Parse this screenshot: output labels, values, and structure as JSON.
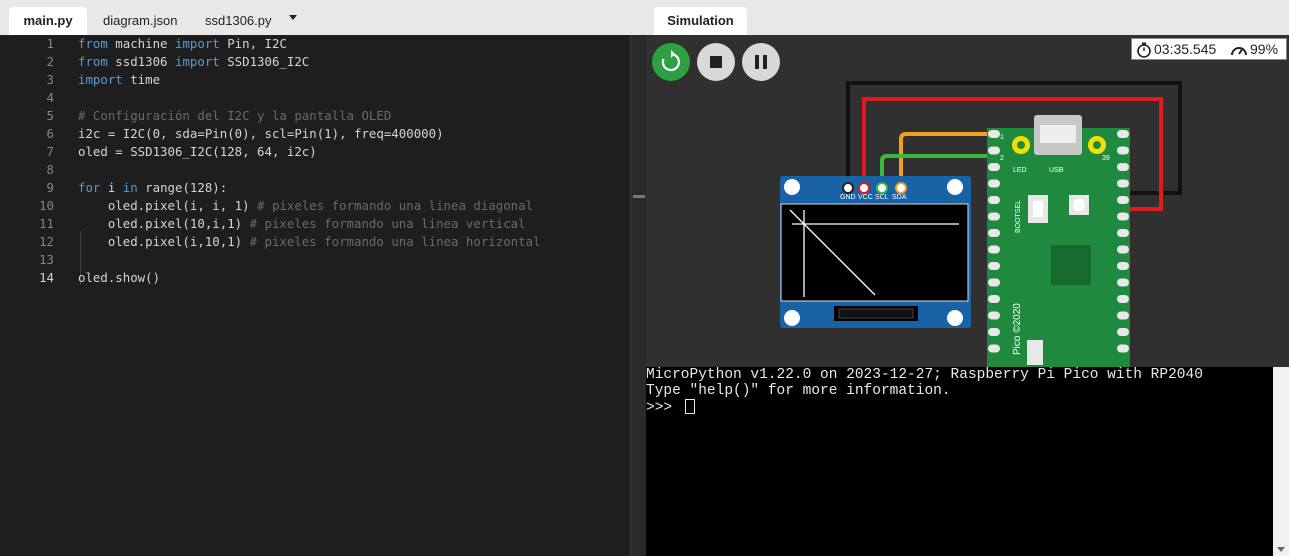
{
  "editor": {
    "tabs": [
      {
        "label": "main.py",
        "active": true
      },
      {
        "label": "diagram.json",
        "active": false
      },
      {
        "label": "ssd1306.py",
        "active": false
      }
    ],
    "current_line": 14,
    "lines": [
      {
        "n": "1",
        "tokens": [
          [
            "kw",
            "from"
          ],
          [
            "nm",
            " machine "
          ],
          [
            "kw",
            "import"
          ],
          [
            "nm",
            " Pin, I2C"
          ]
        ]
      },
      {
        "n": "2",
        "tokens": [
          [
            "kw",
            "from"
          ],
          [
            "nm",
            " ssd1306 "
          ],
          [
            "kw",
            "import"
          ],
          [
            "nm",
            " SSD1306_I2C"
          ]
        ]
      },
      {
        "n": "3",
        "tokens": [
          [
            "kw",
            "import"
          ],
          [
            "nm",
            " time"
          ]
        ]
      },
      {
        "n": "4",
        "tokens": []
      },
      {
        "n": "5",
        "tokens": [
          [
            "cm",
            "# Configuración del I2C y la pantalla OLED"
          ]
        ]
      },
      {
        "n": "6",
        "tokens": [
          [
            "nm",
            "i2c = I2C(0, sda=Pin(0), scl=Pin(1), freq=400000)"
          ]
        ]
      },
      {
        "n": "7",
        "tokens": [
          [
            "nm",
            "oled = SSD1306_I2C(128, 64, i2c)"
          ]
        ]
      },
      {
        "n": "8",
        "tokens": []
      },
      {
        "n": "9",
        "tokens": [
          [
            "kw",
            "for"
          ],
          [
            "nm",
            " i "
          ],
          [
            "kw",
            "in"
          ],
          [
            "nm",
            " range(128):"
          ]
        ]
      },
      {
        "n": "10",
        "tokens": [
          [
            "nm",
            "    oled.pixel(i, i, 1) "
          ],
          [
            "cm",
            "# pixeles formando una linea diagonal"
          ]
        ]
      },
      {
        "n": "11",
        "tokens": [
          [
            "nm",
            "    oled.pixel(10,i,1) "
          ],
          [
            "cm",
            "# pixeles formando una linea vertical"
          ]
        ]
      },
      {
        "n": "12",
        "tokens": [
          [
            "nm",
            "    oled.pixel(i,10,1) "
          ],
          [
            "cm",
            "# pixeles formando una linea horizontal"
          ]
        ]
      },
      {
        "n": "13",
        "tokens": []
      },
      {
        "n": "14",
        "tokens": [
          [
            "nm",
            "oled.show()"
          ]
        ]
      }
    ]
  },
  "simulation": {
    "tab_label": "Simulation",
    "timer": "03:35.545",
    "speed": "99%",
    "controls": {
      "restart": "restart-icon",
      "stop": "stop-icon",
      "pause": "pause-icon"
    },
    "oled": {
      "pins": [
        "GND",
        "VCC",
        "SCL",
        "SDA"
      ]
    },
    "pico": {
      "labels": {
        "led": "LED",
        "usb": "USB",
        "bootsel": "BOOTSEL",
        "pin1": "1",
        "pin2": "2",
        "pin39": "39",
        "name": "Pico ©2020"
      }
    },
    "wire_colors": {
      "gnd": "#111111",
      "vcc": "#e01b1b",
      "scl": "#3cb83c",
      "sda": "#f0a020"
    }
  },
  "console": {
    "lines": [
      "MicroPython v1.22.0 on 2023-12-27; Raspberry Pi Pico with RP2040",
      "Type \"help()\" for more information.",
      ">>> "
    ]
  }
}
